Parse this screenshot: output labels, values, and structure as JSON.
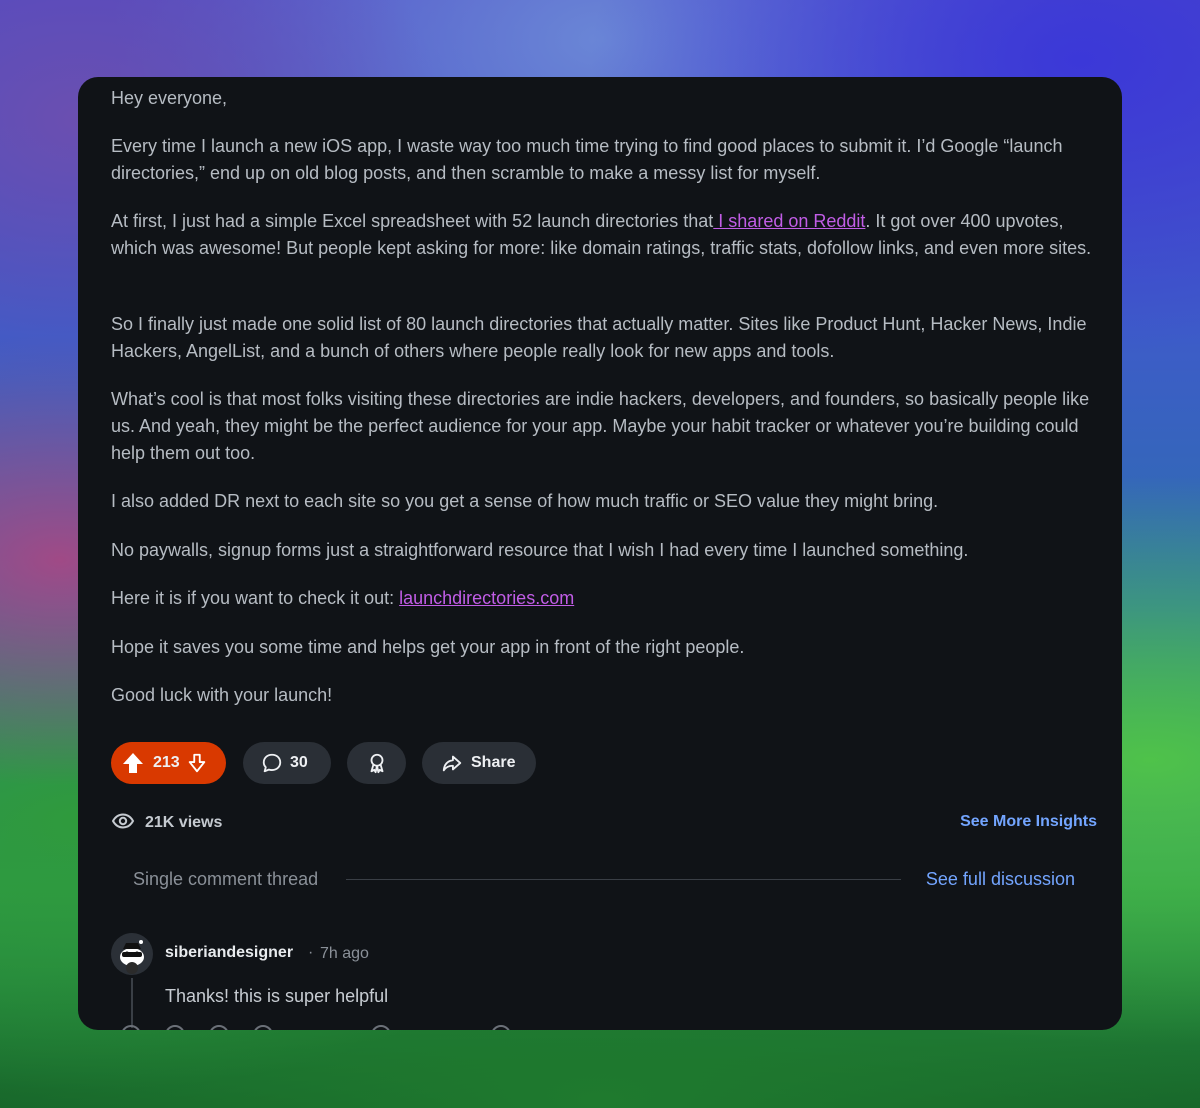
{
  "post": {
    "paragraphs": [
      {
        "text": "Hey everyone,"
      },
      {
        "text": "Every time I launch a new iOS app, I waste way too much time trying to find good places to submit it. I’d Google “launch directories,” end up on old blog posts, and then scramble to make a messy list for myself."
      },
      {
        "before": "At first, I just had a simple Excel spreadsheet with 52 launch directories that",
        "link": " I shared on Reddit",
        "after": ". It got over 400 upvotes, which was awesome! But people kept asking for more: like domain ratings, traffic stats, dofollow links, and even more sites."
      },
      {
        "text": "So I finally just made one solid list of 80 launch directories that actually matter. Sites like Product Hunt, Hacker News, Indie Hackers, AngelList, and a bunch of others where people really look for new apps and tools."
      },
      {
        "text": "What’s cool is that most folks visiting these directories are indie hackers, developers, and founders, so basically people like us. And yeah, they might be the perfect audience for your app. Maybe your habit tracker or whatever you’re building could help them out too."
      },
      {
        "text": "I also added DR next to each site so you get a sense of how much traffic or SEO value they might bring."
      },
      {
        "text": "No paywalls, signup forms just a straightforward resource that I wish I had every time I launched something."
      },
      {
        "before": "Here it is if you want to check it out: ",
        "link": "launchdirectories.com",
        "after": ""
      },
      {
        "text": "Hope it saves you some time and helps get your app in front of the right people."
      },
      {
        "text": "Good luck with your launch!"
      }
    ]
  },
  "actions": {
    "upvotes": "213",
    "comments": "30",
    "share_label": "Share"
  },
  "stats": {
    "views": "21K views",
    "insights_link": "See More Insights"
  },
  "thread": {
    "label": "Single comment thread",
    "full_discussion_link": "See full discussion"
  },
  "comment": {
    "author": "siberiandesigner",
    "separator": "·",
    "time": "7h ago",
    "text": "Thanks! this is super helpful"
  },
  "colors": {
    "card_bg": "#101317",
    "body_text": "#b6bcc3",
    "link": "#c15de6",
    "upvote_pill": "#d93900",
    "pill_bg": "#2a2f36",
    "accent_link": "#73a5ff"
  },
  "icons": {
    "upvote": "upvote-arrow-icon",
    "downvote": "downvote-arrow-icon",
    "comment": "comment-bubble-icon",
    "award": "award-icon",
    "share": "share-arrow-icon",
    "views": "views-eye-icon"
  }
}
